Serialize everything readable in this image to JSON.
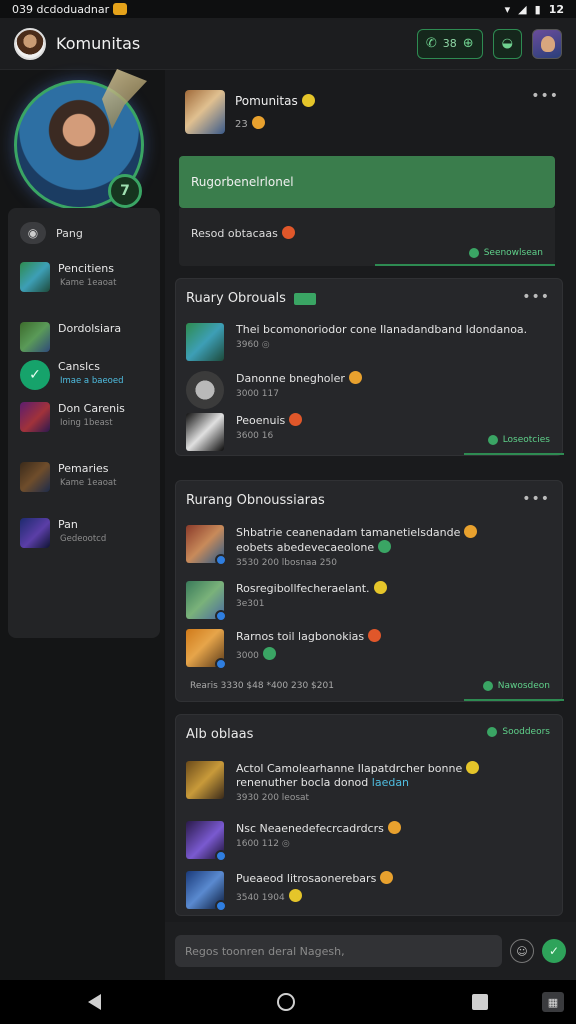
{
  "status_bar": {
    "left_text": "039 dcdoduadnar",
    "time": "12"
  },
  "app_bar": {
    "title": "Komunitas",
    "button1_label": "38"
  },
  "sidebar": {
    "hero_badge": "7",
    "first_item": "Pang",
    "items": [
      {
        "title": "Pencitiens",
        "sub": "Kame 1eaoat"
      },
      {
        "title": "Dordolsiara",
        "sub": ""
      },
      {
        "title": "Canslcs",
        "sub": "Imae a baeoed"
      },
      {
        "title": "Don Carenis",
        "sub": "Ioing 1beast"
      },
      {
        "title": "Pemaries",
        "sub": "Kame 1eaoat"
      },
      {
        "title": "Pan",
        "sub": "Gedeootcd"
      }
    ]
  },
  "top_post": {
    "author": "Pomunitas",
    "sub": "23",
    "banner": "Rugorbenelrlonel",
    "message": "Resod obtacaas",
    "footer": "Seenowlsean"
  },
  "group1": {
    "title": "Ruary Obrouals",
    "rows": [
      {
        "text": "Thei bcomonoriodor cone Ilanadandband Idondanoa.",
        "meta": "3960"
      },
      {
        "text": "Danonne bnegholer",
        "meta": "3000  117"
      },
      {
        "text": "Peoenuis",
        "meta": "3600  16"
      }
    ],
    "footer": "Loseotcies"
  },
  "group2": {
    "title": "Rurang Obnoussiaras",
    "rows": [
      {
        "line1": "Shbatrie ceanenadam tamanetielsdande",
        "line2": "eobets abedevecaeolone",
        "meta": "3530  200 lbosnaa  250"
      },
      {
        "line1": "Rosregibollfecheraelant.",
        "line2": "",
        "meta": "3e301"
      },
      {
        "line1": "Rarnos toil lagbonokias",
        "line2": "",
        "meta": "3000"
      }
    ],
    "stats": "Rearis   3330  $48  *400  230  $201",
    "footer": "Nawosdeon"
  },
  "group3": {
    "title": "Alb oblaas",
    "top_link": "Sooddeors",
    "rows": [
      {
        "line1": "Actol Camolearhanne Ilapatdrcher bonne",
        "line2": "renenuther bocla donod",
        "hl": "laedan",
        "meta": "3930  200 leosat"
      },
      {
        "line1": "Nsc Neaenedefecrcadrdcrs",
        "line2": "",
        "meta": "1600  112"
      },
      {
        "line1": "Pueaeod litrosaonerebars",
        "line2": "",
        "meta": "3540  1904"
      }
    ]
  },
  "input_bar": {
    "placeholder": "Regos toonren deral Nagesh,"
  }
}
